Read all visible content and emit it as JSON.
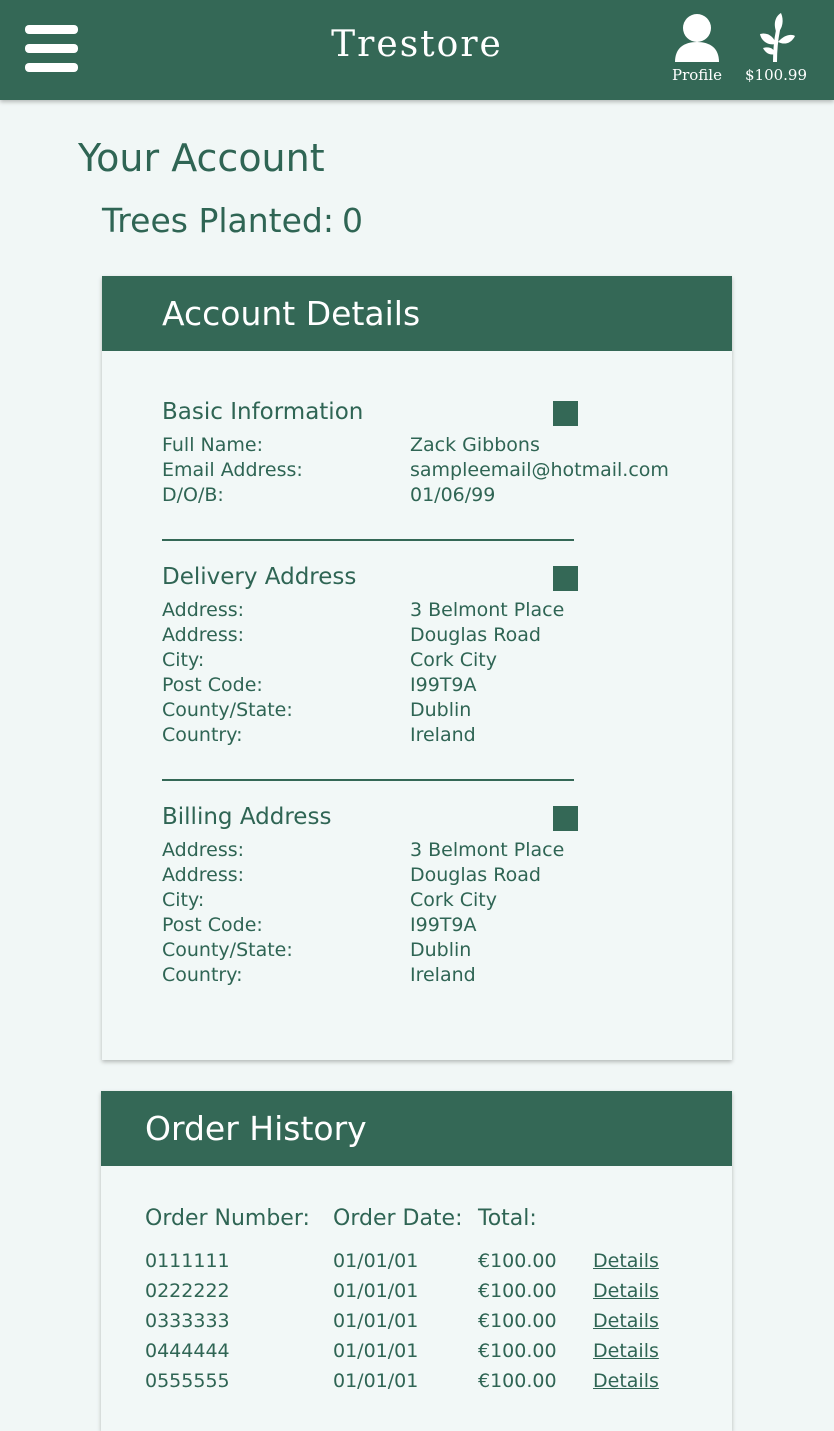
{
  "header": {
    "brand": "Trestore",
    "profile_label": "Profile",
    "balance_label": "$100.99",
    "menu_icon": "hamburger-menu-icon",
    "profile_icon": "user-icon",
    "balance_icon": "leaf-sprout-icon"
  },
  "page": {
    "title": "Your Account",
    "trees_label": "Trees Planted:",
    "trees_value": "0"
  },
  "account_details": {
    "title": "Account Details",
    "basic": {
      "title": "Basic Information",
      "rows": [
        {
          "label": "Full Name:",
          "value": "Zack Gibbons"
        },
        {
          "label": "Email Address:",
          "value": "sampleemail@hotmail.com"
        },
        {
          "label": "D/O/B:",
          "value": "01/06/99"
        }
      ]
    },
    "delivery": {
      "title": "Delivery Address",
      "rows": [
        {
          "label": "Address:",
          "value": "3 Belmont Place"
        },
        {
          "label": "Address:",
          "value": "Douglas Road"
        },
        {
          "label": "City:",
          "value": "Cork City"
        },
        {
          "label": "Post Code:",
          "value": "I99T9A"
        },
        {
          "label": "County/State:",
          "value": "Dublin"
        },
        {
          "label": "Country:",
          "value": "Ireland"
        }
      ]
    },
    "billing": {
      "title": "Billing Address",
      "rows": [
        {
          "label": "Address:",
          "value": "3 Belmont Place"
        },
        {
          "label": "Address:",
          "value": "Douglas Road"
        },
        {
          "label": "City:",
          "value": "Cork City"
        },
        {
          "label": "Post Code:",
          "value": "I99T9A"
        },
        {
          "label": "County/State:",
          "value": "Dublin"
        },
        {
          "label": "Country:",
          "value": "Ireland"
        }
      ]
    }
  },
  "order_history": {
    "title": "Order History",
    "columns": [
      "Order Number:",
      "Order Date:",
      "Total:"
    ],
    "details_label": "Details",
    "rows": [
      {
        "number": "0111111",
        "date": "01/01/01",
        "total": "€100.00",
        "link": "Details"
      },
      {
        "number": "0222222",
        "date": "01/01/01",
        "total": "€100.00",
        "link": "Details"
      },
      {
        "number": "0333333",
        "date": "01/01/01",
        "total": "€100.00",
        "link": "Details"
      },
      {
        "number": "0444444",
        "date": "01/01/01",
        "total": "€100.00",
        "link": "Details"
      },
      {
        "number": "0555555",
        "date": "01/01/01",
        "total": "€100.00",
        "link": "Details"
      }
    ]
  },
  "colors": {
    "primary": "#346856",
    "text": "#2f6554",
    "background": "#f1f7f6",
    "header_text": "#ffffff"
  }
}
